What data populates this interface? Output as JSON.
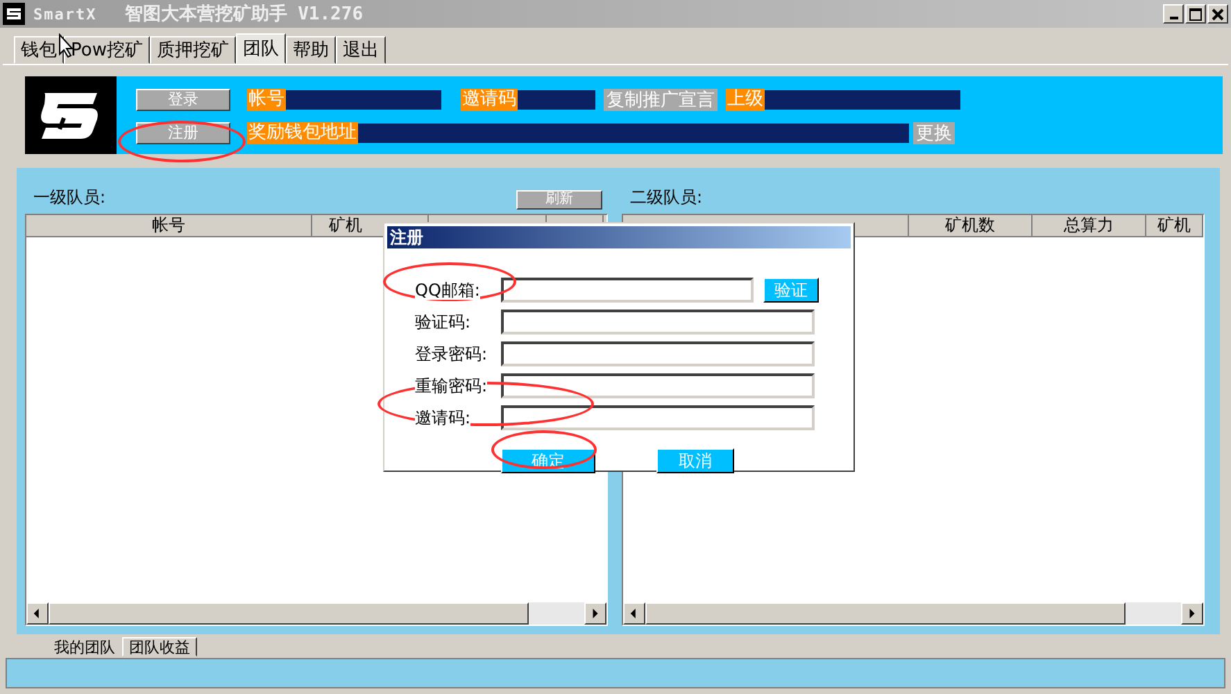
{
  "window": {
    "app_name": "SmartX",
    "title": "智图大本营挖矿助手 V1.276"
  },
  "tabs": [
    {
      "label": "钱包",
      "selected": false
    },
    {
      "label": "Pow挖矿",
      "selected": false
    },
    {
      "label": "质押挖矿",
      "selected": false
    },
    {
      "label": "团队",
      "selected": true
    },
    {
      "label": "帮助",
      "selected": false
    },
    {
      "label": "退出",
      "selected": false
    }
  ],
  "banner": {
    "login_button": "登录",
    "register_button": "注册",
    "account_label": "帐号",
    "invite_label": "邀请码",
    "copy_button": "复制推广宣言",
    "parent_label": "上级",
    "wallet_label": "奖励钱包地址",
    "change_button": "更换"
  },
  "level1": {
    "title": "一级队员:",
    "refresh_button": "刷新",
    "columns": [
      "帐号",
      "矿机"
    ]
  },
  "level2": {
    "title": "二级队员:",
    "columns": [
      "矿机数",
      "总算力",
      "矿机"
    ]
  },
  "bottom_tabs": [
    {
      "label": "我的团队",
      "selected": true
    },
    {
      "label": "团队收益",
      "selected": false
    }
  ],
  "dialog": {
    "title": "注册",
    "fields": [
      {
        "label": "QQ邮箱:",
        "kind": "verify"
      },
      {
        "label": "验证码:",
        "kind": "text"
      },
      {
        "label": "登录密码:",
        "kind": "text"
      },
      {
        "label": "重输密码:",
        "kind": "text"
      },
      {
        "label": "邀请码:",
        "kind": "text"
      }
    ],
    "verify_button": "验证",
    "ok_button": "确定",
    "cancel_button": "取消"
  }
}
